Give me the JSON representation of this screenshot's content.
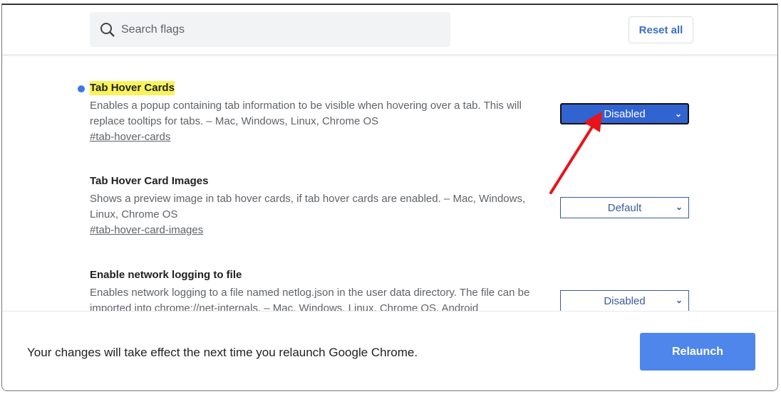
{
  "search": {
    "placeholder": "Search flags"
  },
  "header": {
    "reset_label": "Reset all"
  },
  "flags": [
    {
      "title": "Tab Hover Cards",
      "description": "Enables a popup containing tab information to be visible when hovering over a tab. This will replace tooltips for tabs. – Mac, Windows, Linux, Chrome OS",
      "link": "#tab-hover-cards",
      "value": "Disabled",
      "modified": true
    },
    {
      "title": "Tab Hover Card Images",
      "description": "Shows a preview image in tab hover cards, if tab hover cards are enabled. – Mac, Windows, Linux, Chrome OS",
      "link": "#tab-hover-card-images",
      "value": "Default",
      "modified": false
    },
    {
      "title": "Enable network logging to file",
      "description": "Enables network logging to a file named netlog.json in the user data directory. The file can be imported into chrome://net-internals. – Mac, Windows, Linux, Chrome OS, Android",
      "value": "Disabled",
      "modified": false
    }
  ],
  "footer": {
    "message": "Your changes will take effect the next time you relaunch Google Chrome.",
    "relaunch_label": "Relaunch"
  },
  "colors": {
    "accent": "#4f86ec",
    "highlight": "#f8f35a",
    "annotation": "#e8141a"
  }
}
